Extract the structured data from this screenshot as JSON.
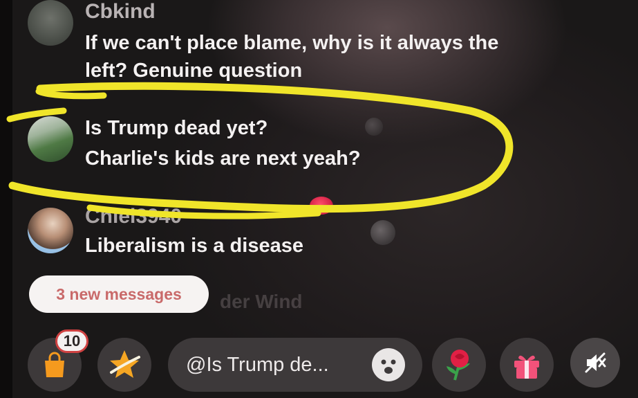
{
  "chat": {
    "messages": [
      {
        "username": "Cbkind",
        "line1": "If we can't place blame, why is it always the",
        "line2": "left? Genuine question"
      },
      {
        "username": "",
        "line1": "Is Trump dead yet?",
        "line2": "Charlie's kids are next yeah?"
      },
      {
        "username": "Chiel3940",
        "line1": "Liberalism is a disease",
        "line2": ""
      }
    ],
    "new_messages_label": "3 new messages",
    "faded_text": "der Wind"
  },
  "bottom_bar": {
    "shop_badge_count": "10",
    "input_text": "@Is Trump de...",
    "icons": {
      "shop": "shopping-bag-icon",
      "star": "star-icon",
      "emoji": "emoji-icon",
      "rose": "rose-icon",
      "gift": "gift-icon",
      "mute": "mute-icon"
    }
  },
  "colors": {
    "highlight": "#f0e52a",
    "bag": "#f59a1e",
    "gift": "#f2527a",
    "rose": "#e02045",
    "new_messages_text": "#c96a6a"
  }
}
